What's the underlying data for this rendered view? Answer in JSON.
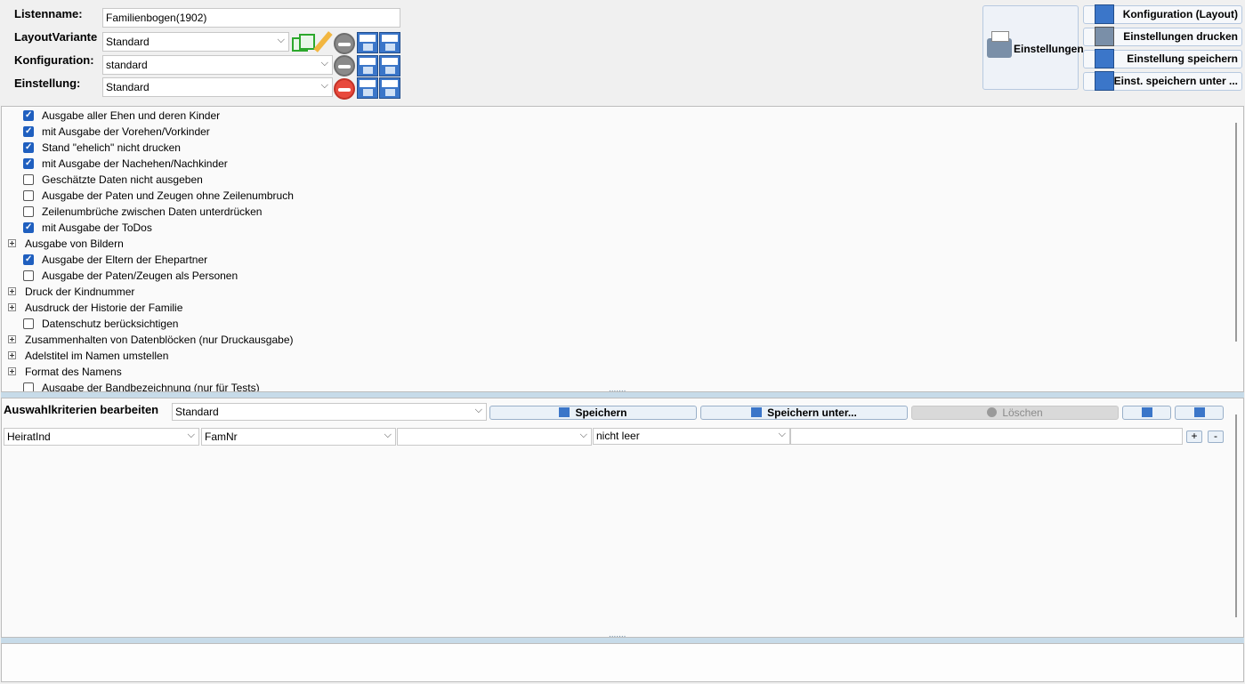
{
  "header": {
    "listname_label": "Listenname:",
    "listname_value": "Familienbogen(1902)",
    "layout_label": "LayoutVariante",
    "layout_value": "Standard",
    "config_label": "Konfiguration:",
    "config_value": "standard",
    "setting_label": "Einstellung:",
    "setting_value": "Standard"
  },
  "toolbar": {
    "settings_label": "Einstellungen",
    "config_layout_label": "Konfiguration (Layout)",
    "print_settings_label": "Einstellungen drucken",
    "save_setting_label": "Einstellung speichern",
    "save_as_label": "Einst. speichern unter ..."
  },
  "options": [
    {
      "label": "Ausgabe aller Ehen und deren Kinder",
      "checked": true
    },
    {
      "label": "mit Ausgabe der Vorehen/Vorkinder",
      "checked": true
    },
    {
      "label": "Stand \"ehelich\" nicht drucken",
      "checked": true
    },
    {
      "label": "mit Ausgabe der Nachehen/Nachkinder",
      "checked": true
    },
    {
      "label": "Geschätzte Daten nicht ausgeben",
      "checked": false
    },
    {
      "label": "Ausgabe der Paten und Zeugen ohne Zeilenumbruch",
      "checked": false
    },
    {
      "label": "Zeilenumbrüche zwischen Daten unterdrücken",
      "checked": false
    },
    {
      "label": "mit Ausgabe der ToDos",
      "checked": true
    },
    {
      "label": "Ausgabe von Bildern",
      "group": true
    },
    {
      "label": "Ausgabe der Eltern der Ehepartner",
      "checked": true
    },
    {
      "label": "Ausgabe der Paten/Zeugen als Personen",
      "checked": false
    },
    {
      "label": "Druck der Kindnummer",
      "group": true
    },
    {
      "label": "Ausdruck der Historie der Familie",
      "group": true
    },
    {
      "label": "Datenschutz berücksichtigen",
      "checked": false
    },
    {
      "label": "Zusammenhalten von Datenblöcken (nur Druckausgabe)",
      "group": true
    },
    {
      "label": "Adelstitel im Namen umstellen",
      "group": true
    },
    {
      "label": "Format des Namens",
      "group": true
    },
    {
      "label": "Ausgabe der Bandbezeichnung (nur für Tests)",
      "checked": false
    }
  ],
  "criteria": {
    "title": "Auswahlkriterien bearbeiten",
    "preset_value": "Standard",
    "save_label": "Speichern",
    "save_as_label": "Speichern unter...",
    "delete_label": "Löschen",
    "field1_value": "HeiratInd",
    "field2_value": "FamNr",
    "field3_value": "",
    "condition_value": "nicht leer",
    "add_label": "+",
    "remove_label": "-"
  }
}
